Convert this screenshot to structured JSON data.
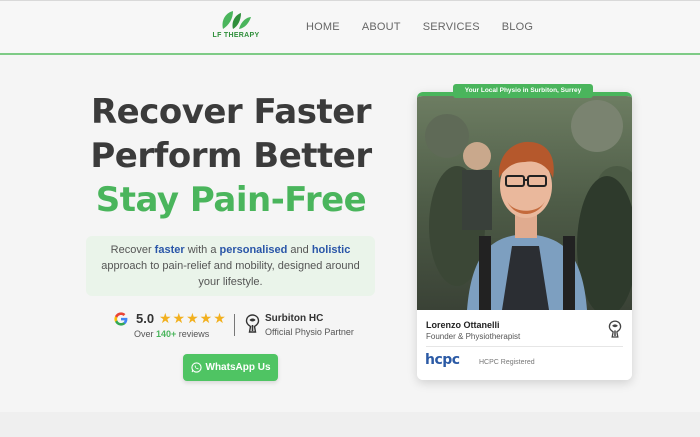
{
  "header": {
    "logo_text": "LF THERAPY",
    "nav": [
      "HOME",
      "ABOUT",
      "SERVICES",
      "BLOG"
    ]
  },
  "hero": {
    "line1": "Recover Faster",
    "line2": "Perform Better",
    "line3": "Stay Pain-Free",
    "intro_parts": [
      "Recover ",
      "faster",
      " with a ",
      "personalised",
      " and ",
      "holistic",
      " approach to pain-relief and mobility, designed around your lifestyle."
    ]
  },
  "rating": {
    "score": "5.0",
    "stars": "★★★★★",
    "reviews_prefix": "Over ",
    "reviews_count": "140+",
    "reviews_suffix": " reviews"
  },
  "partner": {
    "name": "Surbiton HC",
    "subtitle": "Official Physio Partner"
  },
  "cta": {
    "label": "WhatsApp Us"
  },
  "card": {
    "badge": "Your Local Physio in Surbiton, Surrey",
    "name": "Lorenzo Ottanelli",
    "role": "Founder & Physiotherapist",
    "hcpc_logo": "hcpc",
    "hcpc_registered": "HCPC Registered"
  },
  "colors": {
    "accent_green": "#4ab55c",
    "accent_blue": "#2a56a8",
    "star": "#f2b01e"
  }
}
